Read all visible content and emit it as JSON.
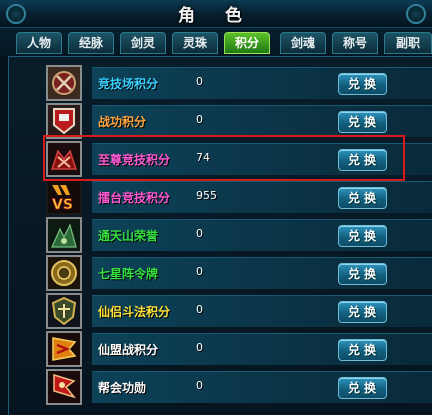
{
  "window": {
    "title": "角 色"
  },
  "tabs": [
    {
      "label": "人物",
      "active": false
    },
    {
      "label": "经脉",
      "active": false
    },
    {
      "label": "剑灵",
      "active": false
    },
    {
      "label": "灵珠",
      "active": false
    },
    {
      "label": "积分",
      "active": true
    },
    {
      "label": "剑魂",
      "active": false
    },
    {
      "label": "称号",
      "active": false
    },
    {
      "label": "副职",
      "active": false
    }
  ],
  "rows": [
    {
      "label": "竞技场积分",
      "value": "0",
      "button": "兑换",
      "label_color": "#39d0ff",
      "icon": "arena-emblem-icon"
    },
    {
      "label": "战功积分",
      "value": "0",
      "button": "兑换",
      "label_color": "#ffa640",
      "icon": "war-banner-icon"
    },
    {
      "label": "至尊竞技积分",
      "value": "74",
      "button": "兑换",
      "label_color": "#ff5ad2",
      "icon": "supreme-arena-icon"
    },
    {
      "label": "擂台竞技积分",
      "value": "955",
      "button": "兑换",
      "label_color": "#ff5ad2",
      "icon": "vs-emblem-icon"
    },
    {
      "label": "通天山荣誉",
      "value": "0",
      "button": "兑换",
      "label_color": "#36e040",
      "icon": "mountain-honor-icon"
    },
    {
      "label": "七星阵令牌",
      "value": "0",
      "button": "兑换",
      "label_color": "#36e040",
      "icon": "seven-star-token-icon"
    },
    {
      "label": "仙侣斗法积分",
      "value": "0",
      "button": "兑换",
      "label_color": "#ffe23a",
      "icon": "shield-emblem-icon"
    },
    {
      "label": "仙盟战积分",
      "value": "0",
      "button": "兑换",
      "label_color": "#ffffff",
      "icon": "alliance-flag-icon"
    },
    {
      "label": "帮会功勋",
      "value": "0",
      "button": "兑换",
      "label_color": "#ffffff",
      "icon": "guild-merit-icon"
    }
  ]
}
